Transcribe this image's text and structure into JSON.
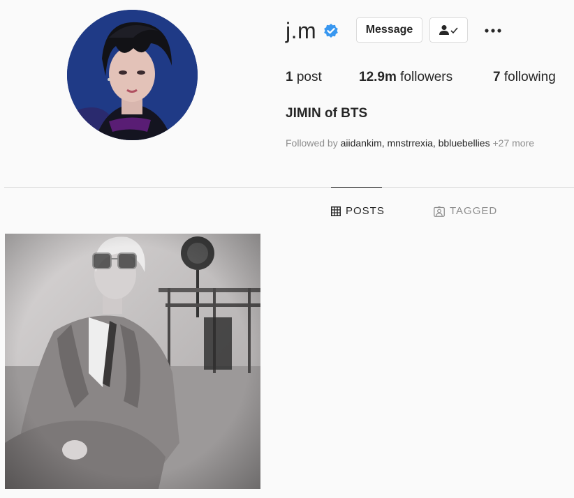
{
  "profile": {
    "username": "j.m",
    "verified": true,
    "buttons": {
      "message": "Message"
    },
    "stats": [
      {
        "count": "1",
        "label": "post"
      },
      {
        "count": "12.9m",
        "label": "followers"
      },
      {
        "count": "7",
        "label": "following"
      }
    ],
    "full_name": "JIMIN of BTS",
    "followed_by": {
      "prefix": "Followed by",
      "names": "aiidankim, mnstrrexia, bbluebellies",
      "more": "+27 more"
    }
  },
  "tabs": [
    {
      "label": "POSTS",
      "icon": "grid-icon",
      "active": true
    },
    {
      "label": "TAGGED",
      "icon": "tag-user-icon",
      "active": false
    }
  ],
  "posts": [
    {
      "thumbnail": "black-and-white photo of person in suit with sunglasses"
    }
  ],
  "colors": {
    "background": "#fafafa",
    "text": "#262626",
    "secondary_text": "#8e8e8e",
    "verified": "#3897f0",
    "border": "#dbdbdb"
  }
}
